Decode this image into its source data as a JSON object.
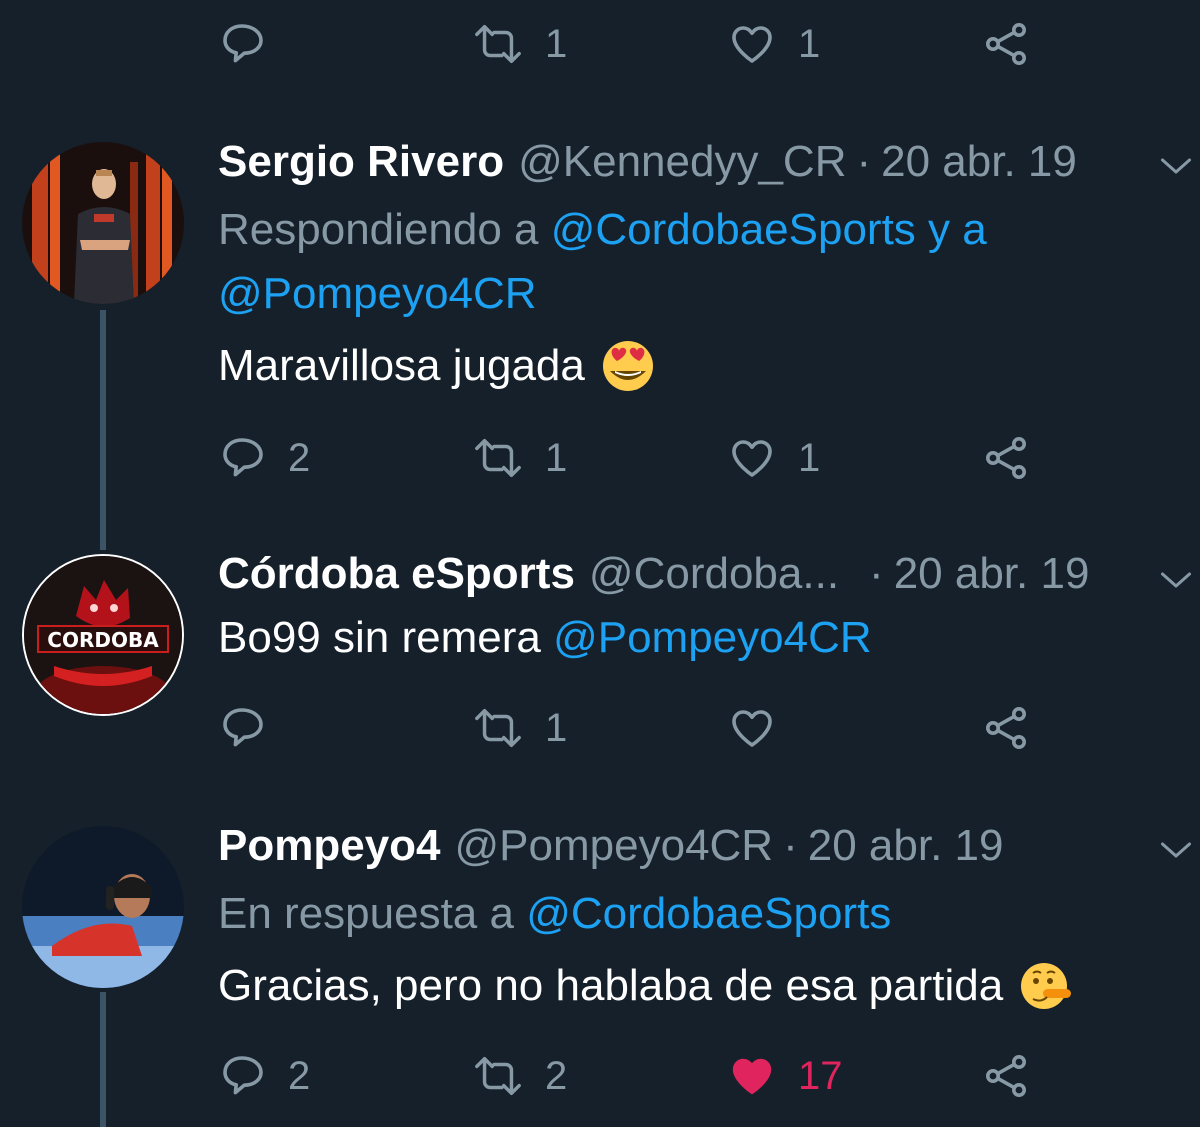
{
  "top_actions": {
    "reply_count": "",
    "retweet_count": "1",
    "like_count": "1"
  },
  "tweets": [
    {
      "name": "Sergio Rivero",
      "handle": "@Kennedyy_CR",
      "date": "20 abr. 19",
      "replying_prefix": "Respondiendo a ",
      "replying_to_1": "@CordobaeSports",
      "replying_join": " y a",
      "replying_to_2": "@Pompeyo4CR",
      "text": "Maravillosa jugada",
      "emoji": "heart-eyes-emoji",
      "reply_count": "2",
      "retweet_count": "1",
      "like_count": "1"
    },
    {
      "name": "Córdoba eSports",
      "handle": "@Cordoba...",
      "date": "20 abr. 19",
      "text": "Bo99 sin remera ",
      "mention": "@Pompeyo4CR",
      "reply_count": "",
      "retweet_count": "1",
      "like_count": ""
    },
    {
      "name": "Pompeyo4",
      "handle": "@Pompeyo4CR",
      "date": "20 abr. 19",
      "replying_prefix": "En respuesta a ",
      "replying_to_1": "@CordobaeSports",
      "text": "Gracias, pero no hablaba de esa partida",
      "emoji": "lying-face-emoji",
      "reply_count": "2",
      "retweet_count": "2",
      "like_count": "17",
      "liked": true
    }
  ],
  "colors": {
    "background": "#15202b",
    "secondary_text": "#8899a6",
    "link": "#1da1f2",
    "like_active": "#e0245e",
    "thread_line": "#3d5466"
  }
}
